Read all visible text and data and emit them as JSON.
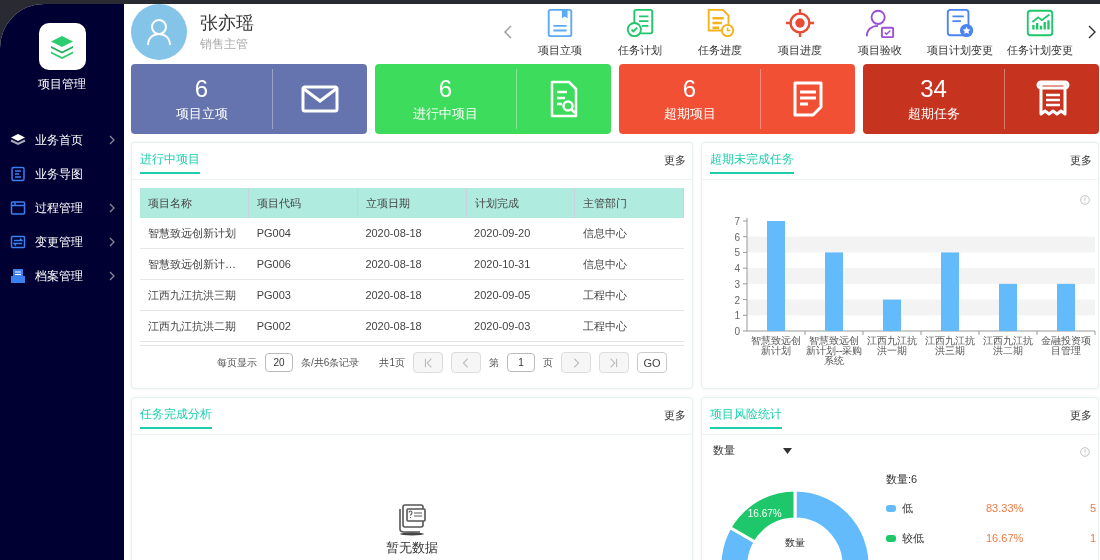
{
  "sidebar": {
    "app_name": "项目管理",
    "items": [
      {
        "label": "业务首页",
        "kind": "stack",
        "expandable": true
      },
      {
        "label": "业务导图",
        "kind": "map",
        "expandable": false
      },
      {
        "label": "过程管理",
        "kind": "window",
        "expandable": true
      },
      {
        "label": "变更管理",
        "kind": "swap",
        "expandable": true
      },
      {
        "label": "档案管理",
        "kind": "tray",
        "expandable": true
      }
    ]
  },
  "header": {
    "user_name": "张亦瑶",
    "user_role": "销售主管",
    "shortcuts": [
      {
        "label": "项目立项",
        "kind": "book"
      },
      {
        "label": "任务计划",
        "kind": "task-check"
      },
      {
        "label": "任务进度",
        "kind": "doc-clock"
      },
      {
        "label": "项目进度",
        "kind": "target"
      },
      {
        "label": "项目验收",
        "kind": "user-calendar"
      },
      {
        "label": "项目计划变更",
        "kind": "doc-star"
      },
      {
        "label": "任务计划变更",
        "kind": "chart-up"
      }
    ]
  },
  "stats": [
    {
      "value": "6",
      "label": "项目立项",
      "color": "#6574ae",
      "kind": "mail"
    },
    {
      "value": "6",
      "label": "进行中项目",
      "color": "#3ddc5c",
      "kind": "doc-search"
    },
    {
      "value": "6",
      "label": "超期项目",
      "color": "#f25034",
      "kind": "note"
    },
    {
      "value": "34",
      "label": "超期任务",
      "color": "#c6341f",
      "kind": "receipt"
    }
  ],
  "ongoing_projects": {
    "title": "进行中项目",
    "more": "更多",
    "table": {
      "columns": [
        "项目名称",
        "项目代码",
        "立项日期",
        "计划完成",
        "主管部门"
      ],
      "rows": [
        [
          "智慧致远创新计划",
          "PG004",
          "2020-08-18",
          "2020-09-20",
          "信息中心"
        ],
        [
          "智慧致远创新计…",
          "PG006",
          "2020-08-18",
          "2020-10-31",
          "信息中心"
        ],
        [
          "江西九江抗洪三期",
          "PG003",
          "2020-08-18",
          "2020-09-05",
          "工程中心"
        ],
        [
          "江西九江抗洪二期",
          "PG002",
          "2020-08-18",
          "2020-09-03",
          "工程中心"
        ]
      ]
    },
    "pagination": {
      "page_size_label": "每页显示",
      "page_size": "20",
      "records": "条/共6条记录",
      "pages": "共1页",
      "page_prefix": "第",
      "page": "1",
      "page_suffix": "页",
      "go": "GO",
      "nav_buttons": [
        {
          "kind": "first",
          "disabled": true
        },
        {
          "kind": "prev",
          "disabled": true
        },
        {
          "kind": "next",
          "disabled": true
        },
        {
          "kind": "last",
          "disabled": true
        }
      ]
    }
  },
  "overdue_tasks": {
    "title": "超期未完成任务",
    "more": "更多",
    "chart_data": {
      "type": "bar",
      "categories": [
        "智慧致远创新计划",
        "智慧致远创新计划--采购系统",
        "江西九江抗洪一期",
        "江西九江抗洪三期",
        "江西九江抗洪二期",
        "金融投资项目管理"
      ],
      "series": [
        {
          "color": "#63bbfc",
          "values": [
            7,
            5,
            2,
            5,
            3,
            3
          ]
        }
      ],
      "ylim": [
        0,
        7
      ],
      "yticks": [
        {
          "value": 0,
          "label": "0"
        },
        {
          "value": 1,
          "label": "1"
        },
        {
          "value": 2,
          "label": "2"
        },
        {
          "value": 3,
          "label": "3"
        },
        {
          "value": 4,
          "label": "4"
        },
        {
          "value": 5,
          "label": "5"
        },
        {
          "value": 6,
          "label": "6"
        },
        {
          "value": 7,
          "label": "7"
        }
      ]
    }
  },
  "task_analysis": {
    "title": "任务完成分析",
    "more": "更多",
    "empty_text": "暂无数据"
  },
  "risk_stats": {
    "title": "项目风险统计",
    "more": "更多",
    "chart_data": {
      "type": "donut",
      "title": "数量",
      "categories": [
        "低",
        "较低"
      ],
      "series": [
        {
          "name": "数量",
          "values": [
            83.33,
            16.67
          ]
        }
      ],
      "legend": true,
      "annotations": [
        {
          "x": "较低",
          "text": "16.67%"
        }
      ]
    },
    "legend": {
      "total": "数量:6",
      "items": [
        {
          "color": "#63bbfc",
          "percent": "83.33%",
          "count": "5"
        },
        {
          "color": "#1ec86a",
          "percent": "16.67%",
          "count": "1"
        }
      ]
    }
  }
}
